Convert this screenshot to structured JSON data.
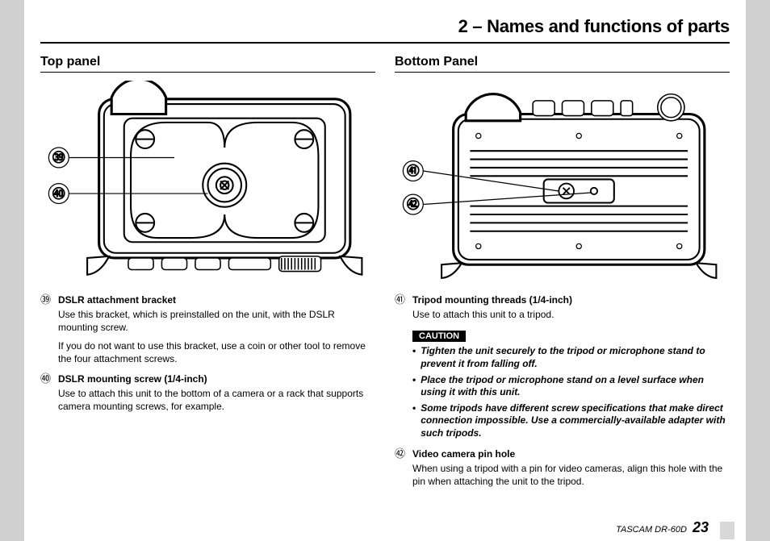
{
  "chapter_title": "2 – Names and functions of parts",
  "left": {
    "section": "Top panel",
    "callouts": [
      "㊴",
      "㊵"
    ],
    "items": [
      {
        "num": "㊴",
        "head": "DSLR attachment bracket",
        "paras": [
          "Use this bracket, which is preinstalled on the unit, with the DSLR mounting screw.",
          "If you do not want to use this bracket, use a coin or other tool to remove the four attachment screws."
        ]
      },
      {
        "num": "㊵",
        "head": "DSLR mounting screw (1/4-inch)",
        "paras": [
          "Use to attach this unit to the bottom of a camera or a rack that supports camera mounting screws, for example."
        ]
      }
    ]
  },
  "right": {
    "section": "Bottom Panel",
    "callouts": [
      "㊶",
      "㊷"
    ],
    "items_before": [
      {
        "num": "㊶",
        "head": "Tripod mounting threads (1/4-inch)",
        "paras": [
          "Use to attach this unit to a tripod."
        ]
      }
    ],
    "caution_label": "CAUTION",
    "cautions": [
      "Tighten the unit securely to the tripod or microphone stand to prevent it from falling off.",
      "Place the tripod or microphone stand on a level surface when using it with this unit.",
      "Some tripods have different screw specifications that make direct connection impossible. Use a commercially-available adapter with such tripods."
    ],
    "items_after": [
      {
        "num": "㊷",
        "head": "Video camera pin hole",
        "paras": [
          "When using a tripod with a pin for video cameras, align this hole with the pin when attaching the unit to the tripod."
        ]
      }
    ]
  },
  "footer_model": "TASCAM  DR-60D",
  "footer_page": "23"
}
